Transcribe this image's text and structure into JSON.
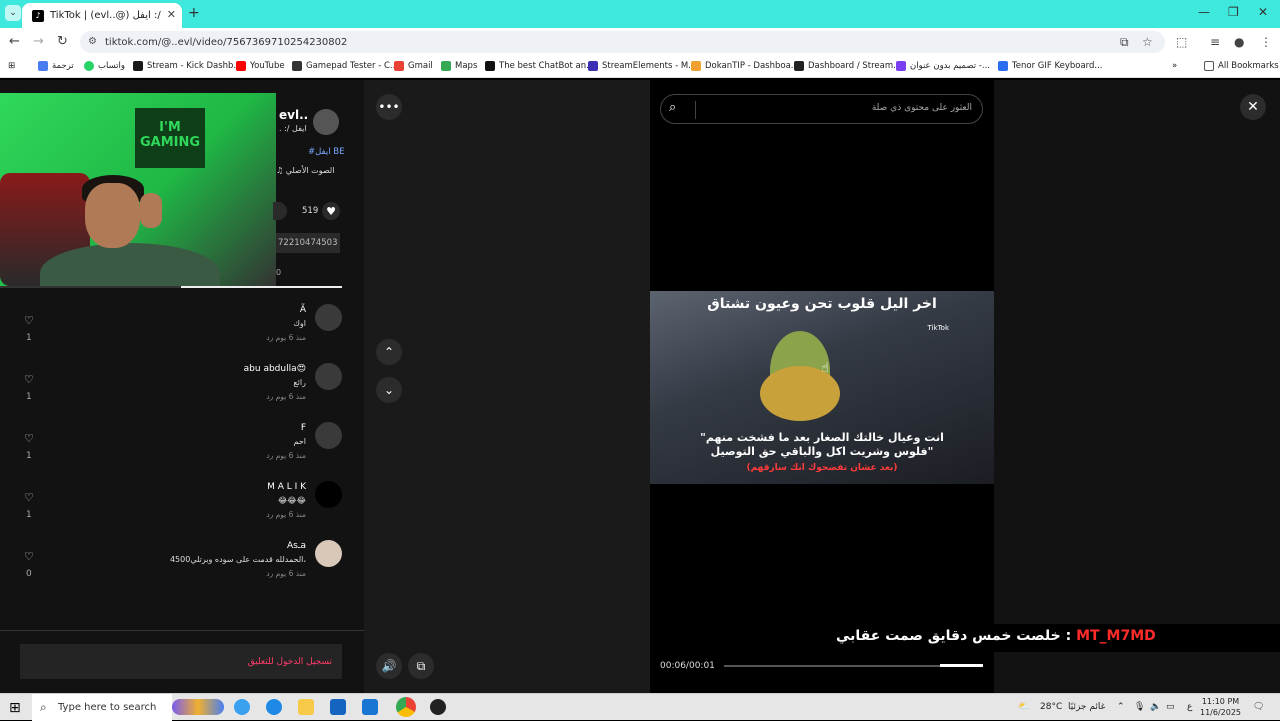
{
  "browser": {
    "tab_title": "TikTok | (evl..@) ايفل :/",
    "url": "tiktok.com/@..evl/video/7567369710254230802",
    "bookmarks": [
      "ترجمة",
      "واتساب",
      "Stream - Kick Dashb...",
      "YouTube",
      "Gamepad Tester - C...",
      "Gmail",
      "Maps",
      "The best ChatBot an...",
      "StreamElements - M...",
      "DokanTIP - Dashboa...",
      "Dashboard / Stream...",
      "تصميم بدون عنوان -...",
      "Tenor GIF Keyboard..."
    ],
    "all_bookmarks": "All Bookmarks"
  },
  "webcam": {
    "sign_text": "I'M GAMING"
  },
  "post": {
    "author_name": "evl..",
    "author_sub": ". :/ ايفل",
    "hashtag": "#ايفل BE",
    "music": "الصوت الأصلي",
    "likes": "519",
    "link_text": "72210474503",
    "link_zero": "0"
  },
  "comments": [
    {
      "name": "Ã",
      "text": "اوك",
      "meta": "منذ 6 يوم     رد",
      "likes": "1"
    },
    {
      "name": "abu abdulla😍",
      "text": "رائع",
      "meta": "منذ 6 يوم     رد",
      "likes": "1"
    },
    {
      "name": "F",
      "text": "احم",
      "meta": "منذ 6 يوم     رد",
      "likes": "1"
    },
    {
      "name": "M A L I K",
      "text": "😂😂😂",
      "meta": "منذ 6 يوم     رد",
      "likes": "1"
    },
    {
      "name": "Asـa",
      "text": "الحمدلله قدمت على سوده وبرتلي4500،",
      "meta": "منذ 6 يوم     رد",
      "likes": "0"
    }
  ],
  "login_text": "تسجيل الدخول للتعليق",
  "search_placeholder": "العثور على محتوى ذي صلة",
  "video": {
    "top_caption": "اخر اليل قلوب تحن وعيون تشتاق",
    "watermark": "TikTok",
    "caption_line1": "\"انت وعيال خالتك الصغار بعد ما فشخت منهم",
    "caption_line2": "فلوس وشريت اكل والباقي حق التوصيل\"",
    "caption_red": "(بعد عشان تفضحوك انك سارقهم)",
    "time": "00:06/00:01"
  },
  "stream_overlay": {
    "prefix": "خلصت خمس دقايق صمت عقابي : ",
    "name": "MT_M7MD"
  },
  "taskbar": {
    "search_placeholder": "Type here to search",
    "temperature": "28°C",
    "weather": "غائم جزئيًا",
    "lang": "ع",
    "time": "11:10 PM",
    "date": "11/6/2025"
  },
  "colors": {
    "tab_strip": "#3ee8dc",
    "accent_red": "#ff3b6a"
  }
}
